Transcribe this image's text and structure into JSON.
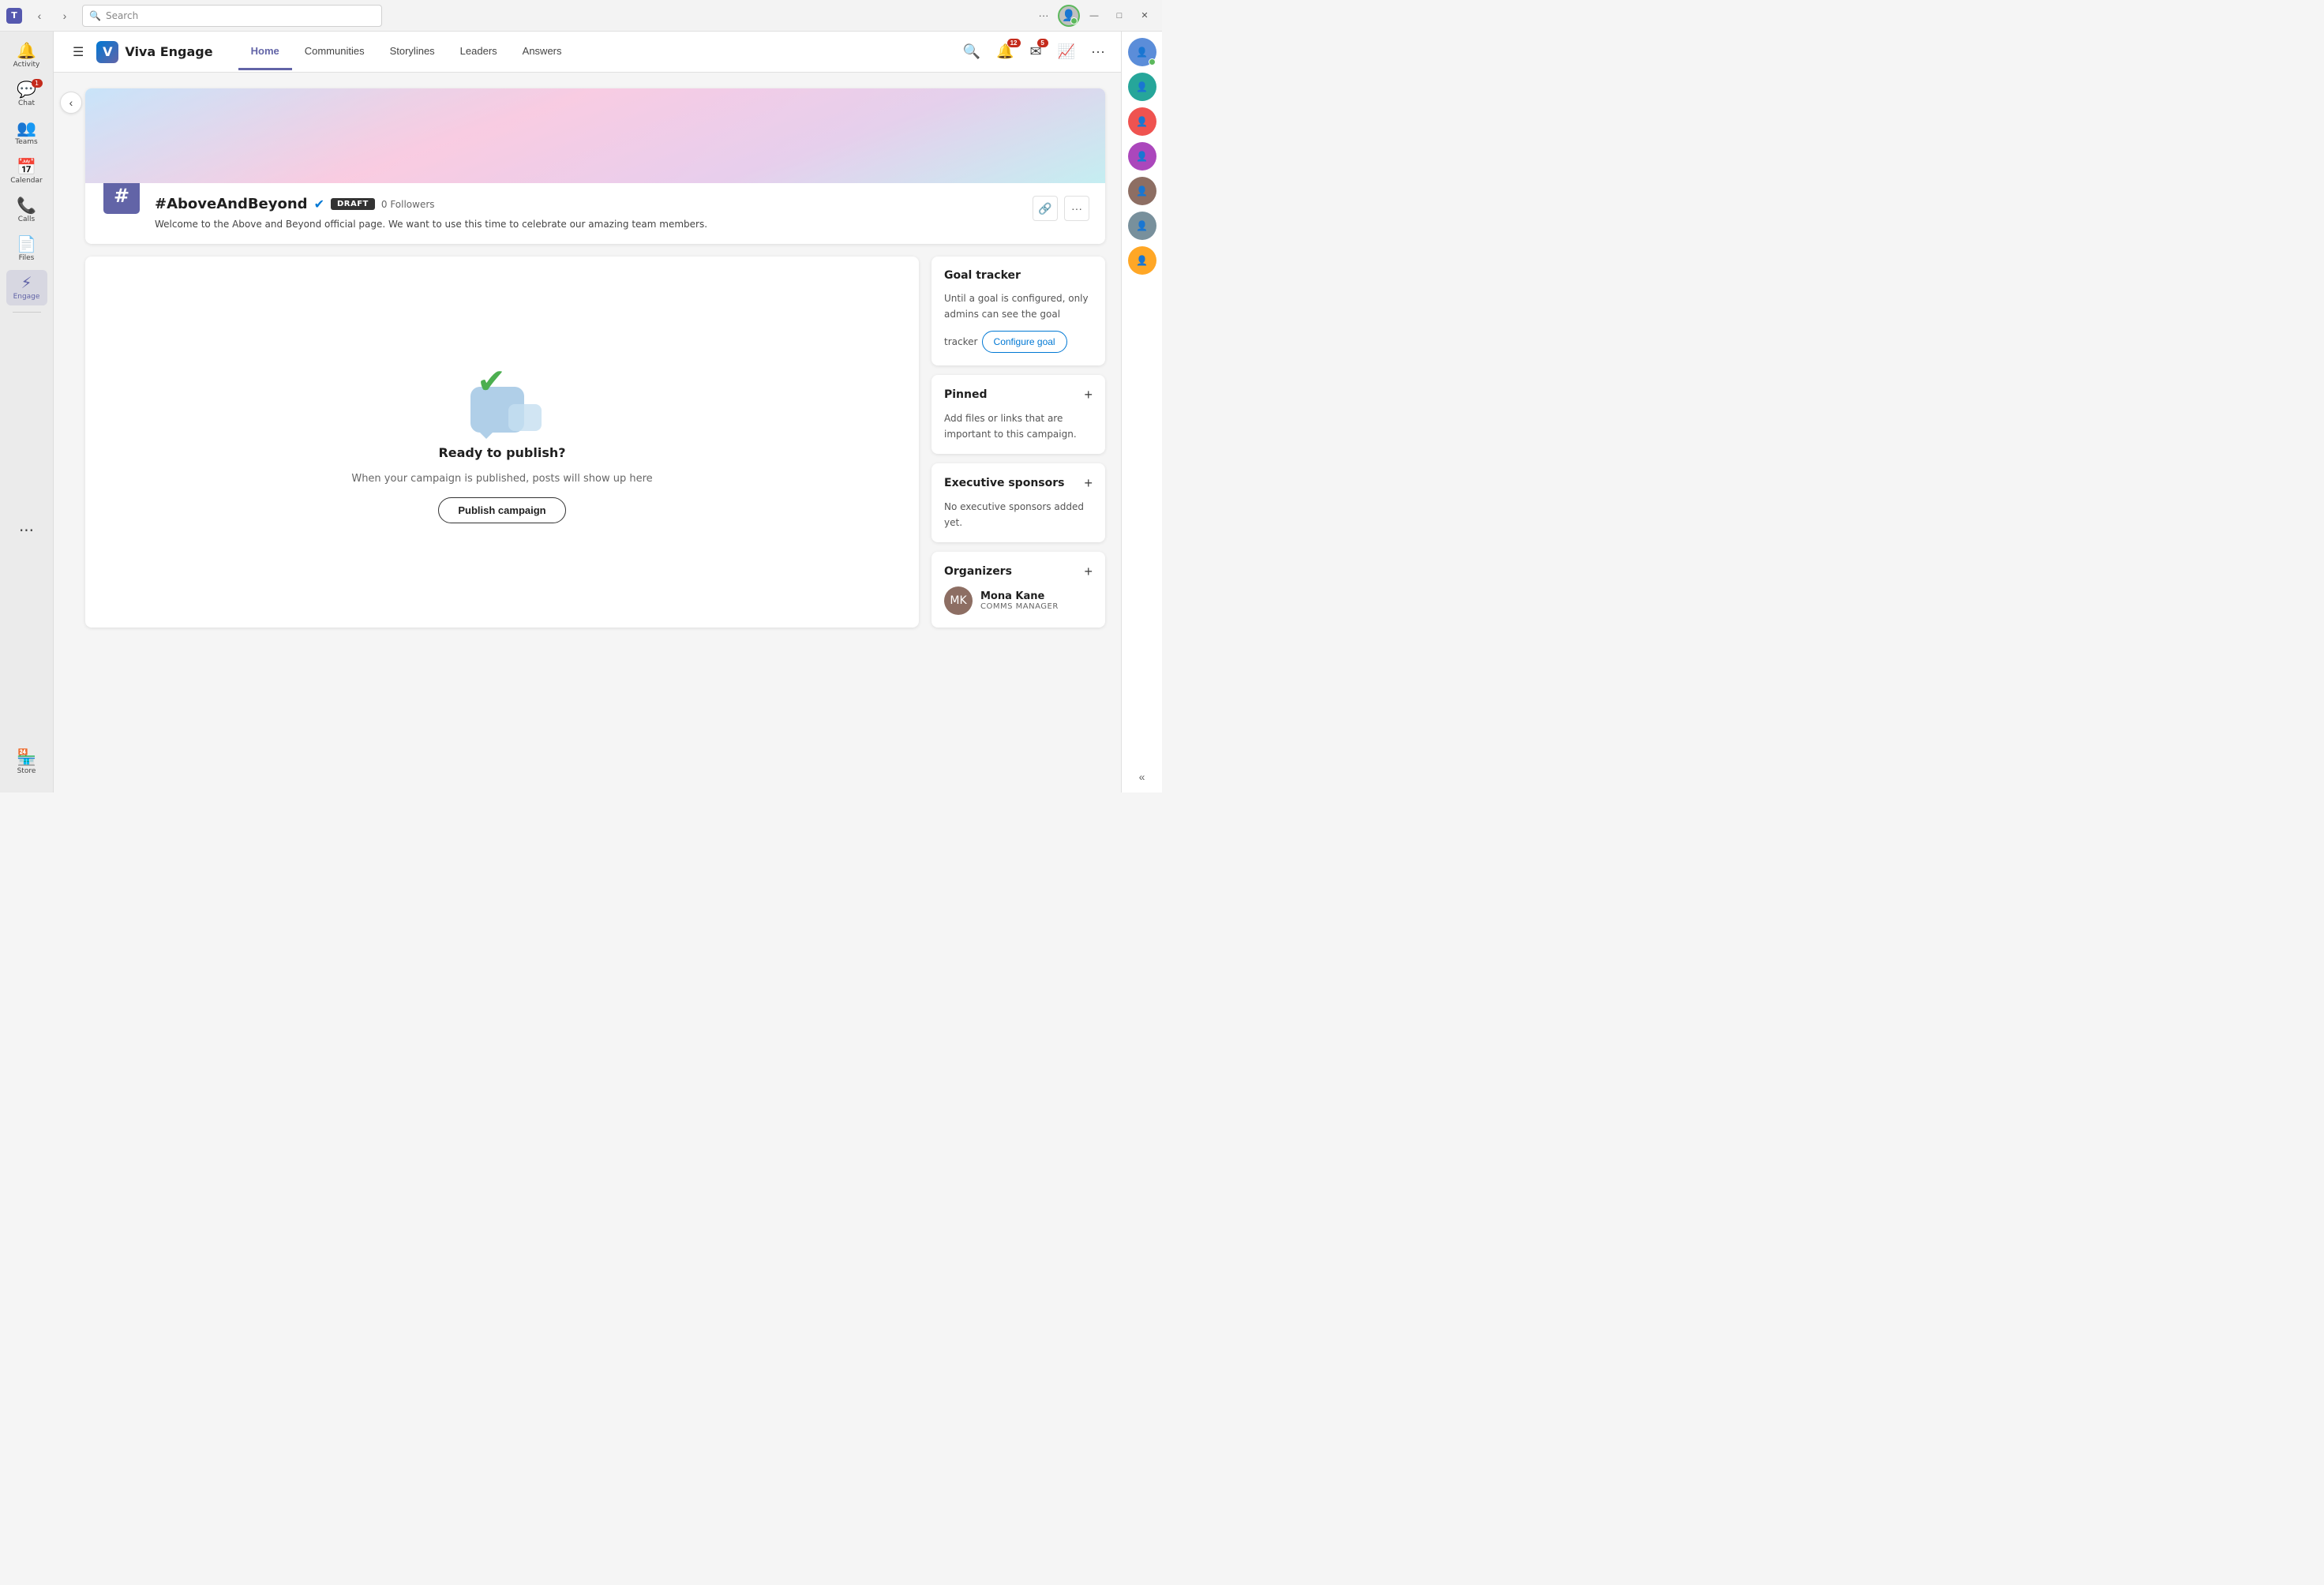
{
  "titleBar": {
    "logo": "T",
    "backLabel": "‹",
    "forwardLabel": "›",
    "search": {
      "placeholder": "Search"
    },
    "moreLabel": "···",
    "userStatus": "online",
    "minimize": "—",
    "maximize": "□",
    "close": "✕"
  },
  "sidebar": {
    "items": [
      {
        "id": "activity",
        "label": "Activity",
        "icon": "🔔",
        "badge": null
      },
      {
        "id": "chat",
        "label": "Chat",
        "icon": "💬",
        "badge": "1"
      },
      {
        "id": "teams",
        "label": "Teams",
        "icon": "👥",
        "badge": null
      },
      {
        "id": "calendar",
        "label": "Calendar",
        "icon": "📅",
        "badge": null
      },
      {
        "id": "calls",
        "label": "Calls",
        "icon": "📞",
        "badge": null
      },
      {
        "id": "files",
        "label": "Files",
        "icon": "📄",
        "badge": null
      },
      {
        "id": "engage",
        "label": "Engage",
        "icon": "⚡",
        "badge": null,
        "active": true
      }
    ],
    "moreLabel": "···",
    "storeLabel": "Store",
    "storeIcon": "🏪"
  },
  "topNav": {
    "hamburgerIcon": "☰",
    "brandName": "Viva Engage",
    "tabs": [
      {
        "id": "home",
        "label": "Home",
        "active": true
      },
      {
        "id": "communities",
        "label": "Communities",
        "active": false
      },
      {
        "id": "storylines",
        "label": "Storylines",
        "active": false
      },
      {
        "id": "leaders",
        "label": "Leaders",
        "active": false
      },
      {
        "id": "answers",
        "label": "Answers",
        "active": false
      }
    ],
    "actions": {
      "searchIcon": "🔍",
      "notifIcon": "🔔",
      "notifBadge": "12",
      "mailIcon": "✉",
      "mailBadge": "5",
      "analyticsIcon": "📈",
      "moreIcon": "···"
    }
  },
  "campaign": {
    "logoText": "#",
    "title": "#AboveAndBeyond",
    "verified": true,
    "status": "DRAFT",
    "followers": "0 Followers",
    "description": "Welcome to the Above and Beyond official page. We want to use this time to celebrate our amazing team members.",
    "linkIcon": "🔗",
    "moreIcon": "···"
  },
  "readySection": {
    "title": "Ready to publish?",
    "description": "When your campaign is published, posts will show up here",
    "publishLabel": "Publish campaign"
  },
  "goalTracker": {
    "title": "Goal tracker",
    "description": "Until a goal is configured, only admins can see the goal tracker",
    "configureLabel": "Configure goal"
  },
  "pinned": {
    "title": "Pinned",
    "addIcon": "+",
    "description": "Add files or links that are important to this campaign."
  },
  "executiveSponsors": {
    "title": "Executive sponsors",
    "addIcon": "+",
    "description": "No executive sponsors added yet."
  },
  "organizers": {
    "title": "Organizers",
    "addIcon": "+",
    "members": [
      {
        "name": "Mona Kane",
        "role": "COMMS MANAGER",
        "initials": "MK"
      }
    ]
  },
  "rightSidebar": {
    "collapseIcon": "«"
  }
}
